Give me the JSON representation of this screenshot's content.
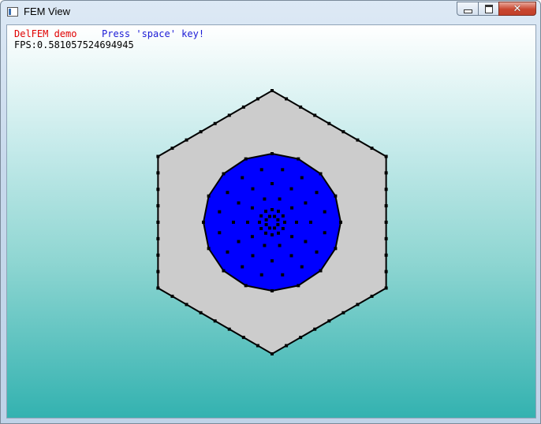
{
  "window": {
    "title": "FEM View",
    "controls": {
      "minimize_icon": "minimize-icon",
      "maximize_icon": "maximize-icon",
      "close_icon": "close-icon"
    }
  },
  "overlay": {
    "demo_label": "DelFEM demo",
    "hint": "Press 'space' key!",
    "fps": "FPS:0.581057524694945"
  },
  "colors": {
    "demo_label": "#e00000",
    "hint": "#1a1ad6",
    "outer_region": "#cccccc",
    "inner_region": "#0000ff",
    "node": "#000000",
    "background_top": "#ffffff",
    "background_bottom": "#33b2b0"
  }
}
